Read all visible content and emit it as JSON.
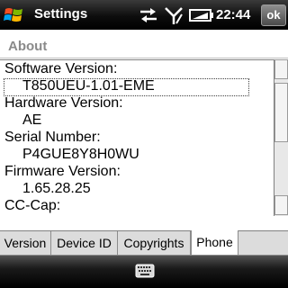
{
  "statusbar": {
    "title": "Settings",
    "time": "22:44",
    "ok_label": "ok",
    "icons": [
      "windows-start-icon",
      "sync-arrows-icon",
      "signal-icon",
      "battery-icon"
    ]
  },
  "page": {
    "title": "About"
  },
  "info": {
    "software_label": "Software Version:",
    "software_value": "T850UEU-1.01-EME",
    "hardware_label": "Hardware Version:",
    "hardware_value": "AE",
    "serial_label": "Serial Number:",
    "serial_value": "P4GUE8Y8H0WU",
    "firmware_label": "Firmware Version:",
    "firmware_value": "1.65.28.25",
    "cccap_label": "CC-Cap:"
  },
  "tabs": [
    {
      "label": "Version",
      "active": false
    },
    {
      "label": "Device ID",
      "active": false
    },
    {
      "label": "Copyrights",
      "active": false
    },
    {
      "label": "Phone",
      "active": true
    }
  ],
  "softbar": {
    "icon": "keyboard-icon"
  },
  "colors": {
    "titlebar": "#000000",
    "page_title": "#8a8a8a",
    "tab_inactive": "#dcdcdc",
    "tab_active": "#ffffff"
  }
}
